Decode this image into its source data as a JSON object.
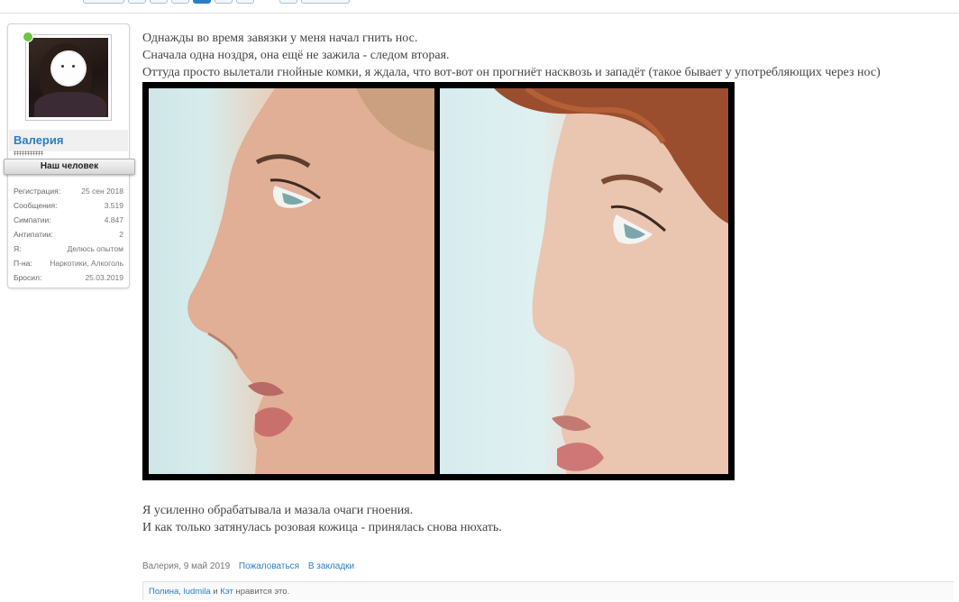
{
  "post": {
    "text_lines_top": [
      "Однажды во время завязки у меня начал гнить нос.",
      "Сначала одна ноздря, она ещё не зажила - следом вторая.",
      "Оттуда просто вылетали гнойные комки, я ждала, что вот-вот он прогниёт насквозь и западёт (такое бывает у употребляющих через нос)"
    ],
    "text_lines_bottom": [
      "Я усиленно обрабатывала и мазала очаги гноения.",
      "И как только затянулась розовая кожица - принялась снова нюхать."
    ],
    "meta": {
      "author_date": "Валерия, 9 май 2019",
      "report_label": "Пожаловаться",
      "bookmark_label": "В закладки"
    },
    "likes": {
      "user1": "Полина",
      "user2": "ludmila",
      "joiner": "и",
      "user3": "Кэт",
      "suffix": "нравится это."
    }
  },
  "user": {
    "name": "Валерия",
    "stars": "‡‡‡‡‡‡‡‡‡‡‡",
    "rank": "Наш человек",
    "stats": [
      {
        "label": "Регистрация:",
        "value": "25 сен 2018"
      },
      {
        "label": "Сообщения:",
        "value": "3.519"
      },
      {
        "label": "Симпатии:",
        "value": "4.847"
      },
      {
        "label": "Антипатии:",
        "value": "2"
      },
      {
        "label": "Я:",
        "value": "Делюсь опытом"
      },
      {
        "label": "П-на:",
        "value": "Наркотики, Алкоголь"
      },
      {
        "label": "Бросил:",
        "value": "25.03.2019"
      }
    ]
  },
  "colors": {
    "link": "#2a7fc4",
    "online": "#6cc644"
  }
}
